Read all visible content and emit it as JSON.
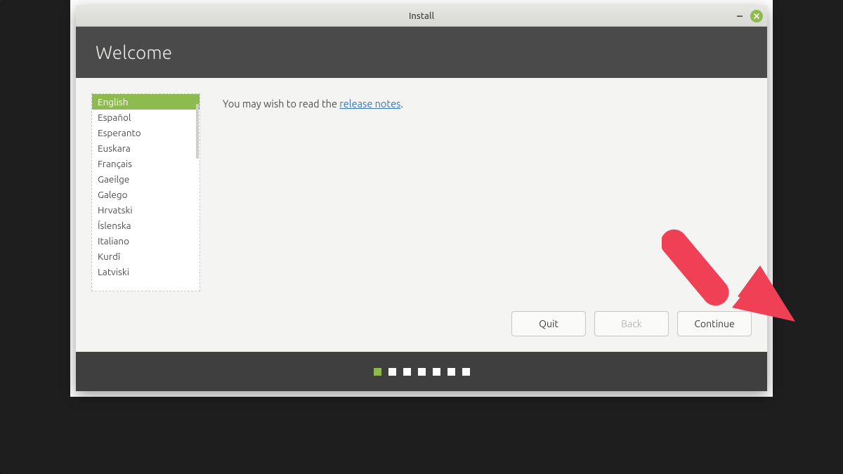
{
  "window": {
    "title": "Install"
  },
  "header": {
    "title": "Welcome"
  },
  "languages": {
    "selected_index": 0,
    "items": [
      "English",
      "Español",
      "Esperanto",
      "Euskara",
      "Français",
      "Gaeilge",
      "Galego",
      "Hrvatski",
      "Íslenska",
      "Italiano",
      "Kurdî",
      "Latviski"
    ]
  },
  "note": {
    "prefix": "You may wish to read the ",
    "link": "release notes",
    "suffix": "."
  },
  "buttons": {
    "quit": "Quit",
    "back": "Back",
    "continue": "Continue"
  },
  "progress": {
    "total_steps": 7,
    "current_step": 1
  },
  "colors": {
    "accent": "#8dbb4f",
    "annotation": "#ef4056"
  }
}
